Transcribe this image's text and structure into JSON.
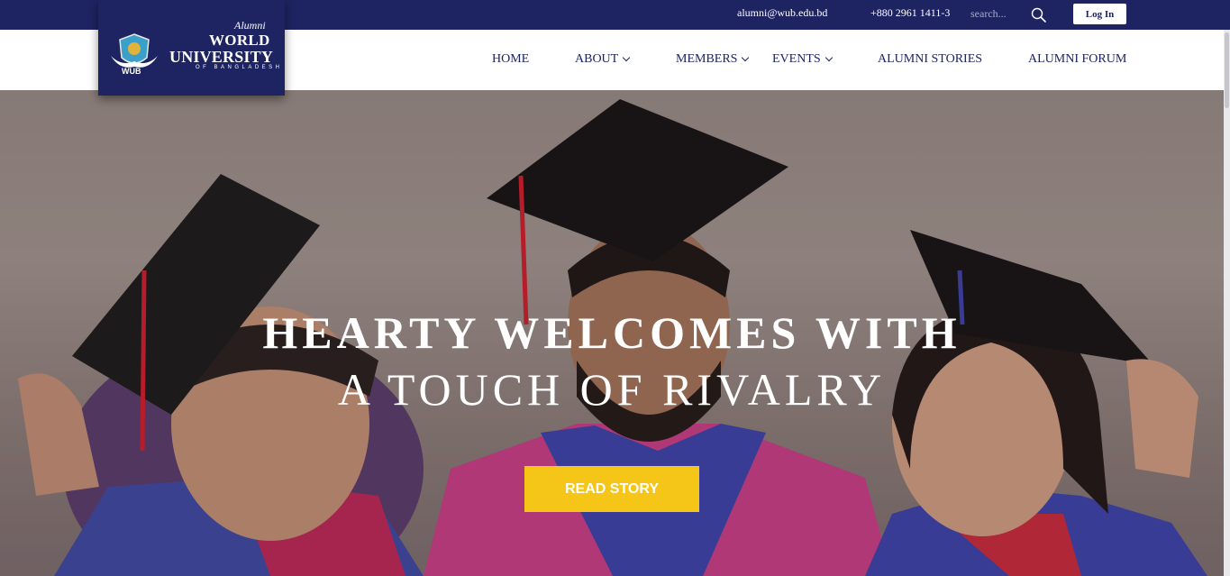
{
  "topbar": {
    "email": "alumni@wub.edu.bd",
    "phone": "+880 2961 1411-3",
    "search_placeholder": "search...",
    "search_icon": "search-icon",
    "login_label": "Log In"
  },
  "logo": {
    "alumni": "Alumni",
    "line1": "WORLD",
    "line2": "UNIVERSITY",
    "line3": "OF BANGLADESH",
    "crest_text": "WUB"
  },
  "nav": {
    "items": [
      {
        "label": "HOME"
      },
      {
        "label": "ABOUT"
      },
      {
        "label": "MEMBERS"
      },
      {
        "label": "EVENTS"
      },
      {
        "label": "ALUMNI STORIES"
      },
      {
        "label": "ALUMNI FORUM"
      }
    ]
  },
  "hero": {
    "headline_line1": "HEARTY WELCOMES WITH",
    "headline_line2": "A TOUCH OF RIVALRY",
    "cta_label": "READ STORY"
  },
  "colors": {
    "brand_navy": "#1d2461",
    "cta_yellow": "#f5c518"
  }
}
